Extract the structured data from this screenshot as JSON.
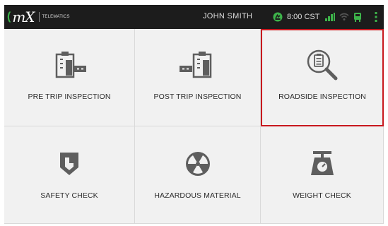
{
  "header": {
    "logo_text": "mX",
    "logo_subtext": "TELEMATICS",
    "user_name": "JOHN SMITH",
    "time": "8:00 CST"
  },
  "colors": {
    "header_bg": "#1c1c1c",
    "tile_bg": "#f1f1f1",
    "icon_gray": "#5e5e5e",
    "accent_green": "#3db34a",
    "selection_red": "#c8181e"
  },
  "tiles": [
    {
      "label": "PRE TRIP INSPECTION",
      "icon": "pre-trip-inspection-icon"
    },
    {
      "label": "POST TRIP INSPECTION",
      "icon": "post-trip-inspection-icon"
    },
    {
      "label": "ROADSIDE INSPECTION",
      "icon": "roadside-inspection-icon",
      "selected": true
    },
    {
      "label": "SAFETY CHECK",
      "icon": "safety-check-icon"
    },
    {
      "label": "HAZARDOUS MATERIAL",
      "icon": "hazardous-material-icon"
    },
    {
      "label": "WEIGHT CHECK",
      "icon": "weight-check-icon"
    }
  ]
}
